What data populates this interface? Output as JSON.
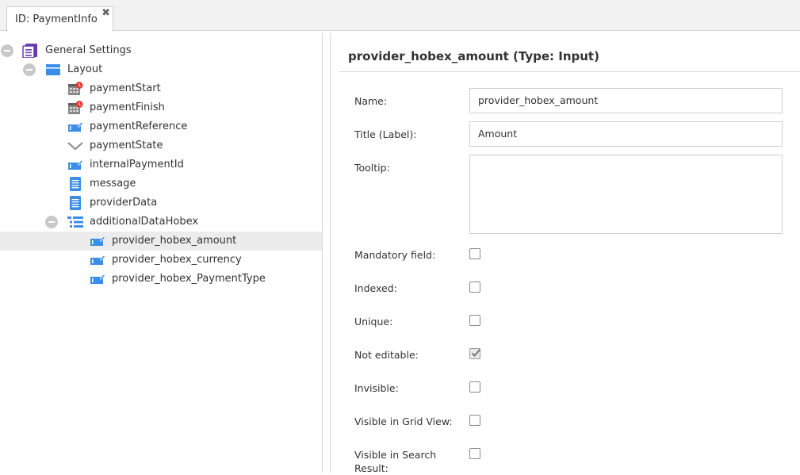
{
  "tab": {
    "label": "ID: PaymentInfo",
    "close_glyph": "✖"
  },
  "tree": {
    "root": {
      "label": "General Settings",
      "icon": "form-icon"
    },
    "layout": {
      "label": "Layout",
      "icon": "panel-icon"
    },
    "fields": [
      {
        "label": "paymentStart",
        "icon": "datetime-icon"
      },
      {
        "label": "paymentFinish",
        "icon": "datetime-icon"
      },
      {
        "label": "paymentReference",
        "icon": "input-icon"
      },
      {
        "label": "paymentState",
        "icon": "select-icon"
      },
      {
        "label": "internalPaymentId",
        "icon": "input-icon"
      },
      {
        "label": "message",
        "icon": "textarea-icon"
      },
      {
        "label": "providerData",
        "icon": "textarea-icon"
      }
    ],
    "group": {
      "label": "additionalDataHobex",
      "icon": "list-icon"
    },
    "group_children": [
      {
        "label": "provider_hobex_amount",
        "icon": "input-icon",
        "selected": true
      },
      {
        "label": "provider_hobex_currency",
        "icon": "input-icon",
        "selected": false
      },
      {
        "label": "provider_hobex_PaymentType",
        "icon": "input-icon",
        "selected": false
      }
    ]
  },
  "panel": {
    "title": "provider_hobex_amount (Type: Input)",
    "name_label": "Name:",
    "name_value": "provider_hobex_amount",
    "title_label": "Title (Label):",
    "title_value": "Amount",
    "tooltip_label": "Tooltip:",
    "tooltip_value": "",
    "checkboxes": [
      {
        "label": "Mandatory field:",
        "checked": false
      },
      {
        "label": "Indexed:",
        "checked": false
      },
      {
        "label": "Unique:",
        "checked": false
      },
      {
        "label": "Not editable:",
        "checked": true
      },
      {
        "label": "Invisible:",
        "checked": false
      },
      {
        "label": "Visible in Grid View:",
        "checked": false
      },
      {
        "label": "Visible in Search Result:",
        "checked": false
      }
    ]
  },
  "colors": {
    "accent_blue": "#3b8de8",
    "root_icon_purple": "#6a3ab2",
    "alert_red": "#e53935",
    "selected_row": "#ececec"
  }
}
